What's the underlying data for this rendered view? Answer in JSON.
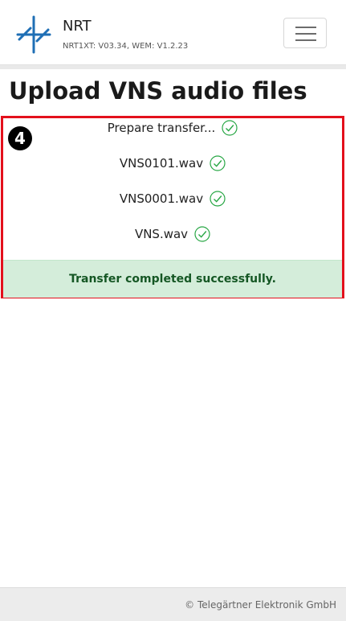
{
  "header": {
    "title": "NRT",
    "subtitle": "NRT1XT: V03.34, WEM: V1.2.23",
    "logo_icon": "telegaertner-logo-icon",
    "menu_icon": "hamburger-menu-icon"
  },
  "page": {
    "title": "Upload VNS audio files",
    "step_number": "4"
  },
  "transfer": {
    "items": [
      {
        "label": "Prepare transfer...",
        "status": "done"
      },
      {
        "label": "VNS0101.wav",
        "status": "done"
      },
      {
        "label": "VNS0001.wav",
        "status": "done"
      },
      {
        "label": "VNS.wav",
        "status": "done"
      }
    ],
    "message": "Transfer completed successfully."
  },
  "footer": {
    "copyright": "© Telegärtner Elektronik GmbH"
  },
  "colors": {
    "highlight_border": "#e3101c",
    "success_bg": "#d4edda",
    "success_text": "#155724",
    "check_green": "#28a745",
    "logo_blue": "#1f6fb5"
  }
}
